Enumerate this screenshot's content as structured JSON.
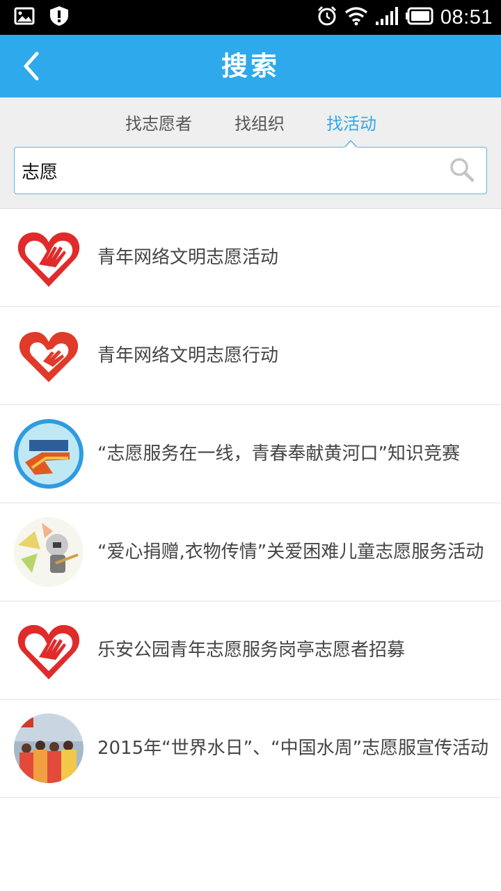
{
  "status_bar": {
    "time": "08:51",
    "left_icons": [
      "gallery-icon",
      "shield-alert-icon"
    ],
    "right_icons": [
      "alarm-icon",
      "wifi-icon",
      "signal-icon",
      "battery-icon"
    ]
  },
  "header": {
    "title": "搜索",
    "back_icon": "chevron-left-icon"
  },
  "tabs": [
    {
      "label": "找志愿者",
      "active": false
    },
    {
      "label": "找组织",
      "active": false
    },
    {
      "label": "找活动",
      "active": true
    }
  ],
  "search": {
    "value": "志愿",
    "icon": "search-icon"
  },
  "results": [
    {
      "title": "青年网络文明志愿活动",
      "avatar": "volunteer-heart-logo"
    },
    {
      "title": "青年网络文明志愿行动",
      "avatar": "volunteer-heart-dove-logo"
    },
    {
      "title": "“志愿服务在一线，青春奉献黄河口”知识竞赛",
      "avatar": "yellow-river-photo"
    },
    {
      "title": "“爱心捐赠,衣物传情”关爱困难儿童志愿服务活动",
      "avatar": "cartoon-robot-image"
    },
    {
      "title": "乐安公园青年志愿服务岗亭志愿者招募",
      "avatar": "volunteer-heart-logo"
    },
    {
      "title": "2015年“世界水日”、“中国水周”志愿服宣传活动",
      "avatar": "volunteer-group-photo"
    }
  ],
  "colors": {
    "accent": "#2ea9eb",
    "logo_red": "#e02b2b",
    "panel_bg": "#efefef"
  }
}
